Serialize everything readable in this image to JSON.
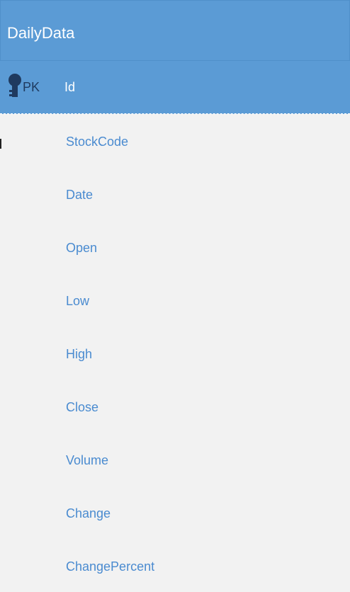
{
  "entity": {
    "name": "DailyData",
    "primary_key": {
      "badge": "PK",
      "field": "Id",
      "icon": "key-icon"
    },
    "fields": [
      "StockCode",
      "Date",
      "Open",
      "Low",
      "High",
      "Close",
      "Volume",
      "Change",
      "ChangePercent"
    ]
  },
  "colors": {
    "header": "#5b9bd5",
    "body": "#f2f2f2",
    "field_text": "#4a8bd0",
    "header_text": "#ffffff",
    "key_icon": "#1f3a5f"
  }
}
